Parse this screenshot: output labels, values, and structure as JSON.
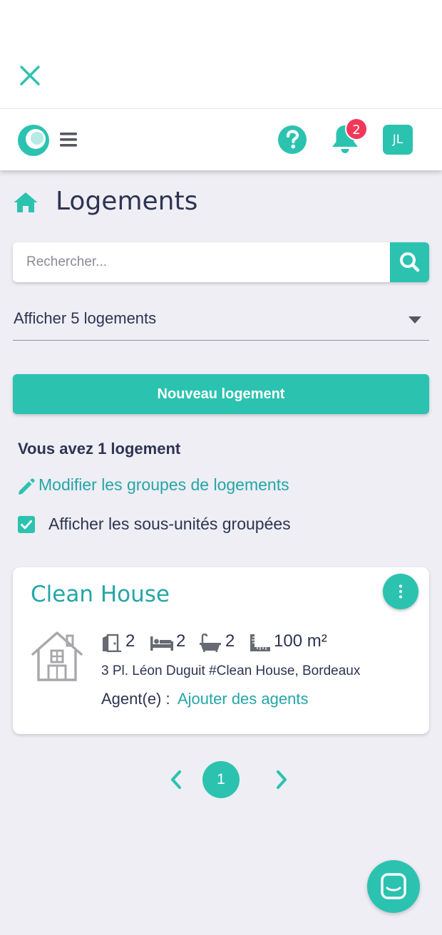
{
  "colors": {
    "accent": "#2bc3b0",
    "link": "#24a6a8",
    "text": "#2e3451",
    "background": "#eeeef4",
    "badge": "#f2385a",
    "muted_icon": "#a7a7ac"
  },
  "header": {
    "close_icon": "close-icon",
    "notifications_count": "2",
    "avatar_initials": "JL"
  },
  "page": {
    "title": "Logements"
  },
  "search": {
    "placeholder": "Rechercher...",
    "value": ""
  },
  "filter": {
    "selected": "Afficher 5 logements"
  },
  "actions": {
    "new_label": "Nouveau logement"
  },
  "summary": {
    "count_text": "Vous avez 1 logement",
    "edit_groups_label": "Modifier les groupes de logements",
    "show_subunits_label": "Afficher les sous-unités groupées",
    "show_subunits_checked": true
  },
  "properties": [
    {
      "name": "Clean House",
      "rooms": "2",
      "beds": "2",
      "bathrooms": "2",
      "area": "100 m²",
      "address": "3 Pl. Léon Duguit #Clean House, Bordeaux",
      "agent_label": "Agent(e) :",
      "agent_link": "Ajouter des agents"
    }
  ],
  "pagination": {
    "current": "1"
  }
}
